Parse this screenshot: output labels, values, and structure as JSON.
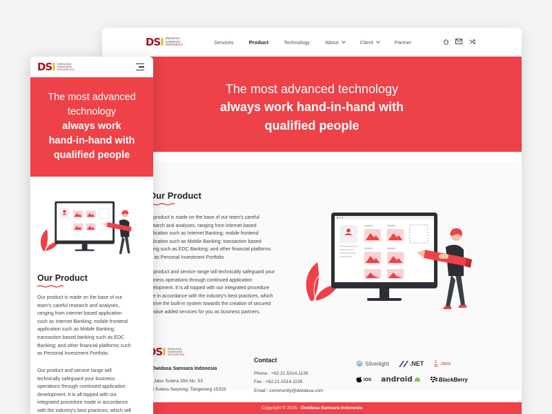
{
  "brand": {
    "mark_d": "D",
    "mark_s": "S",
    "mark_i": "I",
    "line1": "DWIDASA",
    "line2": "SAMSARA",
    "line3": "INDONESIA"
  },
  "nav": {
    "items": [
      {
        "label": "Services",
        "dropdown": false,
        "active": false
      },
      {
        "label": "Product",
        "dropdown": false,
        "active": true
      },
      {
        "label": "Technology",
        "dropdown": false,
        "active": false
      },
      {
        "label": "About",
        "dropdown": true,
        "active": false
      },
      {
        "label": "Client",
        "dropdown": true,
        "active": false
      },
      {
        "label": "Partner",
        "dropdown": false,
        "active": false
      }
    ],
    "icons": [
      "home-icon",
      "mail-icon",
      "shuffle-icon"
    ]
  },
  "hero": {
    "line1": "The most advanced technology",
    "line2": "always work hand-in-hand with",
    "line3": "qualified people"
  },
  "mobile_hero": {
    "line1": "The most advanced",
    "line2": "technology",
    "line3": "always work",
    "line4": "hand-in-hand with",
    "line5": "qualified people"
  },
  "product": {
    "title": "Our Product",
    "desktop_p1": [
      "ur product is made on the base of our team's careful",
      "esearch and analyses, ranging from internet based",
      "pplication such as Internet Banking; mobile frontend",
      "pplication such as Mobile Banking; transaction based",
      "nking such as EDC Banking; and other financial platforms",
      "ch as Personal Investment Portfolio."
    ],
    "desktop_p2": [
      "ur product and service range will technically safeguard your",
      "usiness operations through continued application",
      "evelopment. It is all topped with our integrated procedure",
      "ade in accordance with the industry's best practices, which",
      "ll drive the built-in system towards the creation of secured",
      "d value added services for you as business partners."
    ],
    "mobile_p1": [
      "Our product is made on the base of our",
      "team's careful research and analyses,",
      "ranging from internet based application",
      "such as Internet Banking; mobile frontend",
      "application such as Mobile Banking;",
      "transaction based banking such as EDC",
      "Banking; and other financial platforms such",
      "as Personal Investment Portfolio."
    ],
    "mobile_p2": [
      "Our product and service range will",
      "technically safeguard your business",
      "operations through continued application",
      "development. It is all topped with our",
      "integrated procedure made in accordance",
      "with the industry's best practices, which will"
    ]
  },
  "footer": {
    "company": "Dwidasa Samsara Indonesia",
    "company_prefix": "T",
    "address1": "ko Jalur Sutera 29A No. 53",
    "address2": "am Sutera Serpong, Tangerang 15323",
    "contact_title": "Contact",
    "phone": "Phone : +62.21.5314.1135",
    "fax": "Fax : +62.21.5314.1135",
    "email": "Email : community@dwidasa.com",
    "tech": [
      "Silverlight",
      ".NET",
      "Java",
      "iOS",
      "android",
      "BlackBerry"
    ],
    "copyright_prefix": "Copyright © 2015 - ",
    "copyright_company": "Dwidasa Samsara Indonesia"
  },
  "colors": {
    "accent": "#ee4148",
    "brand_red": "#a31421",
    "brand_yellow": "#f2b51c"
  }
}
